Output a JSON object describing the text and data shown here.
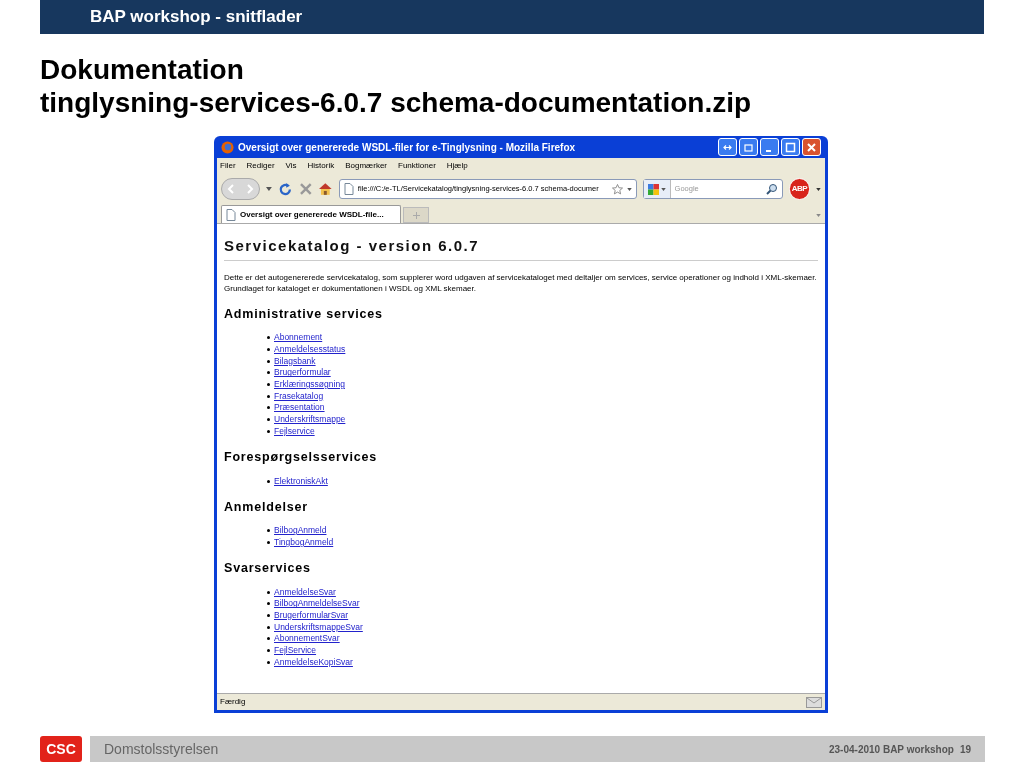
{
  "slide": {
    "header": "BAP workshop - snitflader",
    "title_lines": [
      "Dokumentation",
      "tinglysning-services-6.0.7 schema-documentation.zip"
    ]
  },
  "browser": {
    "title": "Oversigt over genererede WSDL-filer for e-Tinglysning - Mozilla Firefox",
    "menu": [
      "Filer",
      "Rediger",
      "Vis",
      "Historik",
      "Bogmærker",
      "Funktioner",
      "Hjælp"
    ],
    "url": "file:///C:/e-TL/Servicekatalog/tinglysning-services-6.0.7 schema-documer",
    "search": {
      "placeholder": "Google"
    },
    "adblock": "ABP",
    "tab": {
      "label": "Oversigt over genererede WSDL-file...",
      "selected": true
    },
    "page": {
      "heading": "Servicekatalog - version 6.0.7",
      "intro": "Dette er det autogenererede servicekatalog, som supplerer word udgaven af servicekataloget med deltaljer om services, service operationer og indhold i XML-skemaer. Grundlaget for kataloget er dokumentationen i WSDL og XML skemaer.",
      "sections": [
        {
          "heading": "Administrative services",
          "links": [
            "Abonnement",
            "Anmeldelsesstatus",
            "Bilagsbank",
            "Brugerformular",
            "Erklæringssøgning",
            "Frasekatalog",
            "Præsentation",
            "Underskriftsmappe",
            "Fejlservice"
          ]
        },
        {
          "heading": "Forespørgselsservices",
          "links": [
            "ElektroniskAkt"
          ]
        },
        {
          "heading": "Anmeldelser",
          "links": [
            "BilbogAnmeld",
            "TingbogAnmeld"
          ]
        },
        {
          "heading": "Svarservices",
          "links": [
            "AnmeldelseSvar",
            "BilbogAnmeldelseSvar",
            "BrugerformularSvar",
            "UnderskriftsmappeSvar",
            "AbonnementSvar",
            "FejlService",
            "AnmeldelseKopiSvar"
          ]
        }
      ]
    },
    "status": "Færdig"
  },
  "footer": {
    "logo": "CSC",
    "organization": "Domstolsstyrelsen",
    "info": "23-04-2010 BAP workshop",
    "page": "19"
  }
}
